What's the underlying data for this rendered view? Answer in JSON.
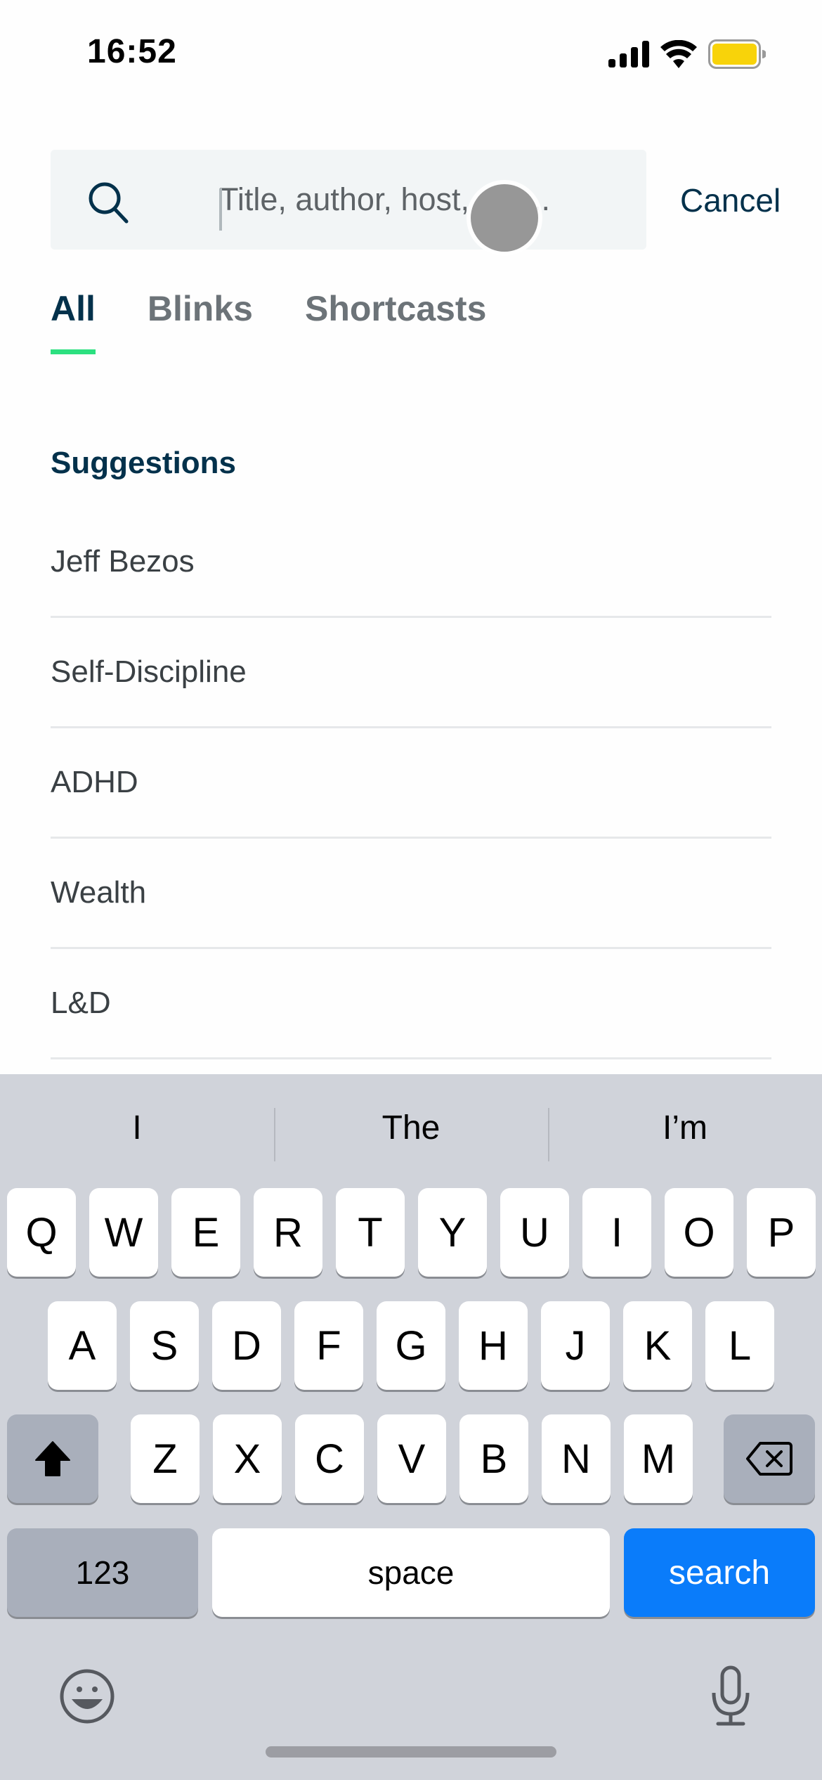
{
  "status_bar": {
    "time": "16:52",
    "icons": [
      "cellular-signal-icon",
      "wifi-icon",
      "battery-icon"
    ],
    "battery_color": "#f8d30a"
  },
  "search": {
    "placeholder": "Title, author, host, or t...",
    "value": "",
    "cancel_label": "Cancel"
  },
  "tabs": [
    {
      "label": "All",
      "active": true
    },
    {
      "label": "Blinks",
      "active": false
    },
    {
      "label": "Shortcasts",
      "active": false
    }
  ],
  "suggestions": {
    "title": "Suggestions",
    "items": [
      "Jeff Bezos",
      "Self-Discipline",
      "ADHD",
      "Wealth",
      "L&D"
    ]
  },
  "keyboard": {
    "predictions": [
      "I",
      "The",
      "I’m"
    ],
    "row1": [
      "Q",
      "W",
      "E",
      "R",
      "T",
      "Y",
      "U",
      "I",
      "O",
      "P"
    ],
    "row2": [
      "A",
      "S",
      "D",
      "F",
      "G",
      "H",
      "J",
      "K",
      "L"
    ],
    "row3": [
      "Z",
      "X",
      "C",
      "V",
      "B",
      "N",
      "M"
    ],
    "numbers_label": "123",
    "space_label": "space",
    "search_label": "search"
  },
  "colors": {
    "accent": "#2ce080",
    "primary_text": "#03314b",
    "keyboard_action": "#0a7cfa"
  }
}
